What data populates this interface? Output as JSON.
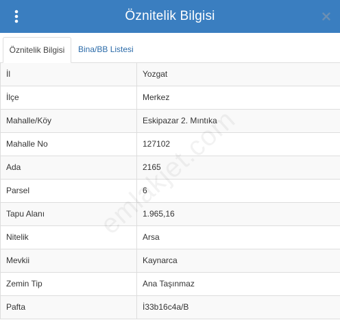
{
  "header": {
    "title": "Öznitelik Bilgisi",
    "menu_icon": "vertical-dots-icon",
    "close_icon": "close-icon"
  },
  "tabs": [
    {
      "label": "Öznitelik Bilgisi",
      "active": true
    },
    {
      "label": "Bina/BB Listesi",
      "active": false
    }
  ],
  "attributes": [
    {
      "key": "İl",
      "value": "Yozgat"
    },
    {
      "key": "İlçe",
      "value": "Merkez"
    },
    {
      "key": "Mahalle/Köy",
      "value": "Eskipazar 2. Mıntıka"
    },
    {
      "key": "Mahalle No",
      "value": "127102"
    },
    {
      "key": "Ada",
      "value": "2165"
    },
    {
      "key": "Parsel",
      "value": "6"
    },
    {
      "key": "Tapu Alanı",
      "value": "1.965,16"
    },
    {
      "key": "Nitelik",
      "value": "Arsa"
    },
    {
      "key": "Mevkii",
      "value": "Kaynarca"
    },
    {
      "key": "Zemin Tip",
      "value": "Ana Taşınmaz"
    },
    {
      "key": "Pafta",
      "value": "İ33b16c4a/B"
    }
  ],
  "watermark": "emlakjet.com",
  "colors": {
    "header_bg": "#3a7ec0",
    "tab_link": "#2a6aa8",
    "border": "#dddddd"
  }
}
